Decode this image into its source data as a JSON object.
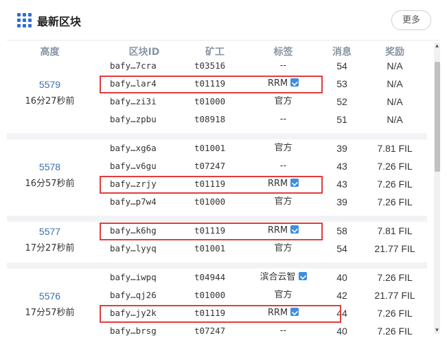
{
  "header": {
    "title": "最新区块",
    "more_label": "更多"
  },
  "columns": {
    "height": "高度",
    "block_id": "区块ID",
    "miner": "矿工",
    "tag": "标签",
    "messages": "消息",
    "reward": "奖励"
  },
  "groups": [
    {
      "height": "5579",
      "age": "16分27秒前",
      "blocks": [
        {
          "cid": "bafy…7cra",
          "miner": "t03516",
          "tag": "--",
          "verified": false,
          "messages": "54",
          "reward": "N/A"
        },
        {
          "cid": "bafy…lar4",
          "miner": "t01119",
          "tag": "RRM",
          "verified": true,
          "messages": "53",
          "reward": "N/A",
          "highlighted": true
        },
        {
          "cid": "bafy…zi3i",
          "miner": "t01000",
          "tag": "官方",
          "verified": false,
          "messages": "52",
          "reward": "N/A"
        },
        {
          "cid": "bafy…zpbu",
          "miner": "t08918",
          "tag": "--",
          "verified": false,
          "messages": "51",
          "reward": "N/A"
        }
      ]
    },
    {
      "height": "5578",
      "age": "16分57秒前",
      "blocks": [
        {
          "cid": "bafy…xg6a",
          "miner": "t01001",
          "tag": "官方",
          "verified": false,
          "messages": "39",
          "reward": "7.81 FIL"
        },
        {
          "cid": "bafy…v6gu",
          "miner": "t07247",
          "tag": "--",
          "verified": false,
          "messages": "43",
          "reward": "7.26 FIL"
        },
        {
          "cid": "bafy…zrjy",
          "miner": "t01119",
          "tag": "RRM",
          "verified": true,
          "messages": "43",
          "reward": "7.26 FIL",
          "highlighted": true
        },
        {
          "cid": "bafy…p7w4",
          "miner": "t01000",
          "tag": "官方",
          "verified": false,
          "messages": "39",
          "reward": "7.26 FIL"
        }
      ]
    },
    {
      "height": "5577",
      "age": "17分27秒前",
      "blocks": [
        {
          "cid": "bafy…k6hg",
          "miner": "t01119",
          "tag": "RRM",
          "verified": true,
          "messages": "58",
          "reward": "7.81 FIL",
          "highlighted": true
        },
        {
          "cid": "bafy…lyyq",
          "miner": "t01001",
          "tag": "官方",
          "verified": false,
          "messages": "54",
          "reward": "21.77 FIL"
        }
      ]
    },
    {
      "height": "5576",
      "age": "17分57秒前",
      "blocks": [
        {
          "cid": "bafy…iwpq",
          "miner": "t04944",
          "tag": "滨合云智",
          "verified": true,
          "messages": "40",
          "reward": "7.26 FIL"
        },
        {
          "cid": "bafy…qj26",
          "miner": "t01000",
          "tag": "官方",
          "verified": false,
          "messages": "42",
          "reward": "21.77 FIL"
        },
        {
          "cid": "bafy…jy2k",
          "miner": "t01119",
          "tag": "RRM",
          "verified": true,
          "messages": "44",
          "reward": "7.26 FIL",
          "highlighted": true
        },
        {
          "cid": "bafy…brsg",
          "miner": "t07247",
          "tag": "--",
          "verified": false,
          "messages": "40",
          "reward": "7.26 FIL"
        }
      ]
    }
  ],
  "colors": {
    "link": "#3a6fb0",
    "highlight": "#e23b3b",
    "verified": "#3d8fe0",
    "separator": "#f2f3f5"
  },
  "icons": {
    "logo": "grid-icon",
    "verified": "verified-icon",
    "scroll_up": "chevron-up-icon",
    "scroll_down": "chevron-down-icon"
  }
}
